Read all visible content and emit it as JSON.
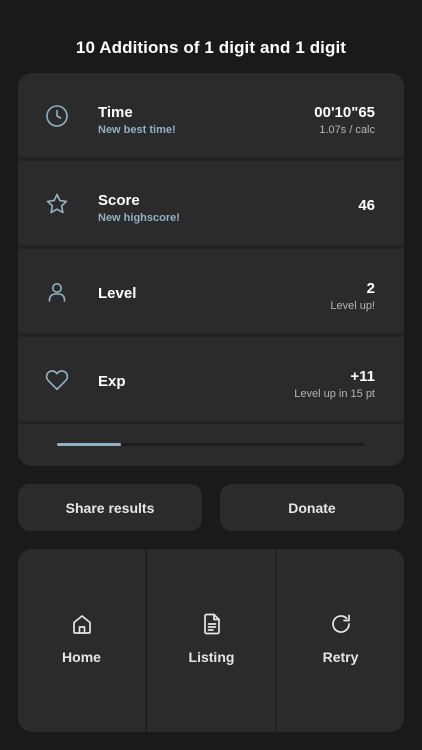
{
  "title": "10 Additions of 1 digit and 1 digit",
  "colors": {
    "background": "#1a1a1a",
    "card": "#2b2b2b",
    "accent": "#8fb3c4"
  },
  "stats": [
    {
      "icon": "clock-icon",
      "label": "Time",
      "sublabel": "New best time!",
      "value": "00'10\"65",
      "subvalue": "1.07s / calc"
    },
    {
      "icon": "star-icon",
      "label": "Score",
      "sublabel": "New highscore!",
      "value": "46",
      "subvalue": ""
    },
    {
      "icon": "user-icon",
      "label": "Level",
      "sublabel": "",
      "value": "2",
      "subvalue": "Level up!"
    },
    {
      "icon": "heart-icon",
      "label": "Exp",
      "sublabel": "",
      "value": "+11",
      "subvalue": "Level up in 15 pt"
    }
  ],
  "exp_progress": 0.21,
  "actions": {
    "share": "Share results",
    "donate": "Donate"
  },
  "nav": [
    {
      "icon": "home-icon",
      "label": "Home"
    },
    {
      "icon": "document-icon",
      "label": "Listing"
    },
    {
      "icon": "refresh-icon",
      "label": "Retry"
    }
  ]
}
